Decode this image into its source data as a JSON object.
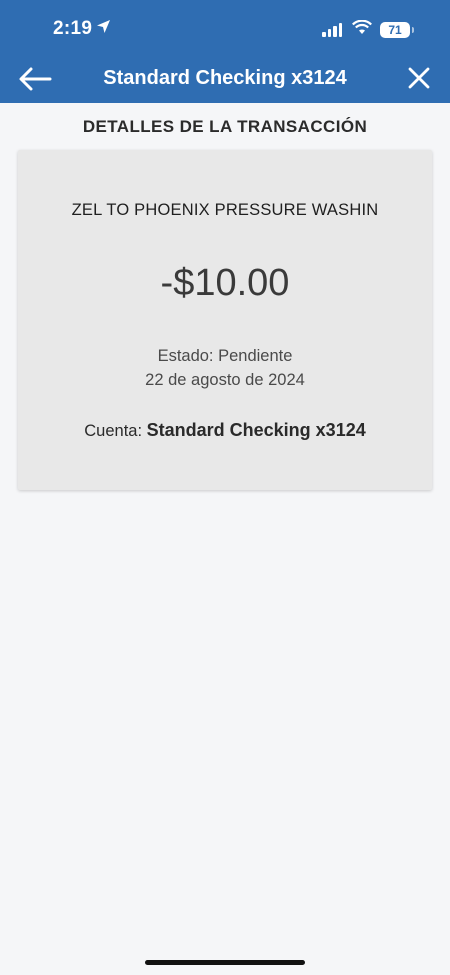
{
  "status_bar": {
    "time": "2:19",
    "battery": "71"
  },
  "nav": {
    "title": "Standard Checking x3124"
  },
  "section_title": "DETALLES DE LA TRANSACCIÓN",
  "transaction": {
    "merchant": "ZEL TO PHOENIX PRESSURE WASHIN",
    "amount": "-$10.00",
    "status": "Estado: Pendiente",
    "date": "22 de agosto de 2024",
    "account_label": "Cuenta:",
    "account_value": "Standard Checking x3124"
  },
  "colors": {
    "header": "#2f6db2",
    "card": "#e8e8e8",
    "background": "#f5f6f8"
  }
}
